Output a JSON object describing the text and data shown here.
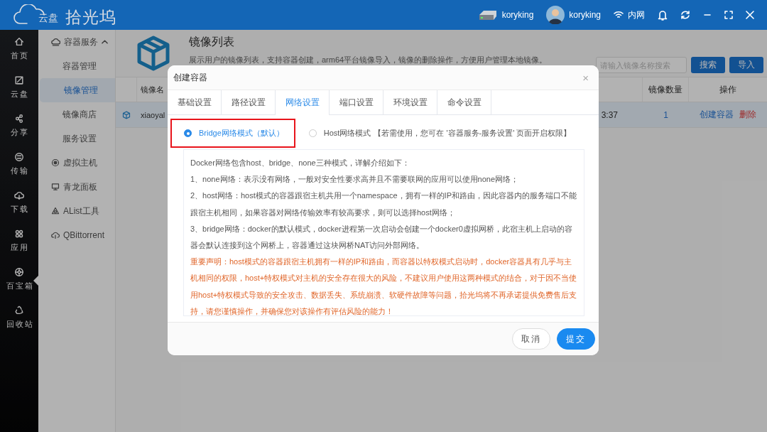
{
  "header": {
    "logo_badge": "云盘",
    "app_name": "拾光坞",
    "device": "koryking",
    "user": "koryking",
    "network": "内网"
  },
  "rail": [
    {
      "label": "首页",
      "selected": false
    },
    {
      "label": "云盘",
      "selected": false
    },
    {
      "label": "分享",
      "selected": false
    },
    {
      "label": "传输",
      "selected": false
    },
    {
      "label": "下载",
      "selected": false
    },
    {
      "label": "应用",
      "selected": false
    },
    {
      "label": "百宝箱",
      "selected": true
    },
    {
      "label": "回收站",
      "selected": false
    }
  ],
  "subnav": {
    "group": {
      "label": "容器服务",
      "expanded": true,
      "children": [
        {
          "label": "容器管理",
          "selected": false
        },
        {
          "label": "镜像管理",
          "selected": true
        },
        {
          "label": "镜像商店",
          "selected": false
        },
        {
          "label": "服务设置",
          "selected": false
        }
      ]
    },
    "items": [
      {
        "label": "虚拟主机",
        "selected": false
      },
      {
        "label": "青龙面板",
        "selected": false
      },
      {
        "label": "AList工具",
        "selected": false
      },
      {
        "label": "QBittorrent",
        "selected": false
      }
    ]
  },
  "page": {
    "title": "镜像列表",
    "description": "展示用户的镜像列表，支持容器创建，arm64平台镜像导入，镜像的删除操作，方便用户管理本地镜像。",
    "search": {
      "placeholder": "请输入镜像名称搜索"
    },
    "buttons": [
      "搜索",
      "导入"
    ],
    "table": {
      "headers": {
        "name": "镜像名",
        "count": "镜像数量",
        "actions": "操作"
      },
      "rows": [
        {
          "name": "xiaoyal",
          "column_3": "3:37",
          "count": "1",
          "selected": true,
          "actions": [
            {
              "label": "创建容器",
              "kind": "primary"
            },
            {
              "label": "删除",
              "kind": "danger"
            }
          ]
        }
      ]
    }
  },
  "dialog": {
    "title": "创建容器",
    "close": "×",
    "tabs": [
      {
        "label": "基础设置",
        "selected": false
      },
      {
        "label": "路径设置",
        "selected": false
      },
      {
        "label": "网络设置",
        "selected": true
      },
      {
        "label": "端口设置",
        "selected": false
      },
      {
        "label": "环境设置",
        "selected": false
      },
      {
        "label": "命令设置",
        "selected": false
      }
    ],
    "network_modes": [
      {
        "label": "Bridge网络模式（默认）",
        "selected": true,
        "annotated": true
      },
      {
        "label": "Host网络模式",
        "note": "【若需使用，您可在 '容器服务-服务设置' 页面开启权限】",
        "selected": false,
        "annotated": false
      }
    ],
    "info": [
      {
        "kind": "normal",
        "text": "Docker网络包含host、bridge、none三种模式，详解介绍如下："
      },
      {
        "kind": "normal",
        "text": "1、none网络：表示没有网络，一般对安全性要求高并且不需要联网的应用可以使用none网络；"
      },
      {
        "kind": "normal",
        "text": "2、host网络：host模式的容器跟宿主机共用一个namespace，拥有一样的IP和路由，因此容器内的服务端口不能跟宿主机相同，如果容器对网络传输效率有较高要求，则可以选择host网络；"
      },
      {
        "kind": "normal",
        "text": "3、bridge网络：docker的默认模式，docker进程第一次启动会创建一个docker0虚拟网桥，此宿主机上启动的容器会默认连接到这个网桥上，容器通过这块网桥NAT访问外部网络。"
      },
      {
        "kind": "warning",
        "text": "重要声明：host模式的容器跟宿主机拥有一样的IP和路由，而容器以特权模式启动时，docker容器具有几乎与主机相同的权限，host+特权模式对主机的安全存在很大的风险，不建议用户使用这两种模式的结合，对于因不当使用host+特权模式导致的安全攻击、数据丢失、系统崩溃、软硬件故障等问题，拾光坞将不再承诺提供免费售后支持，请您谨慎操作，并确保您对该操作有评估风险的能力！"
      }
    ],
    "buttons": [
      {
        "label": "取消",
        "kind": "secondary"
      },
      {
        "label": "提交",
        "kind": "primary"
      }
    ]
  }
}
